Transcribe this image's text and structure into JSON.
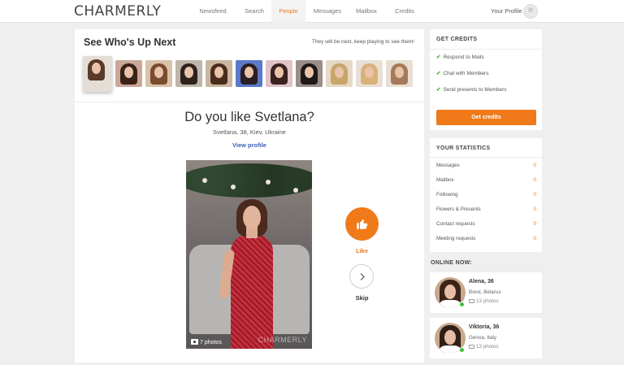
{
  "header": {
    "logo": "CHARMERLY",
    "nav": [
      {
        "label": "Newsfeed",
        "active": false
      },
      {
        "label": "Search",
        "active": false
      },
      {
        "label": "People",
        "active": true
      },
      {
        "label": "Messages",
        "active": false
      },
      {
        "label": "Mailbox",
        "active": false
      },
      {
        "label": "Credits",
        "active": false
      }
    ],
    "profile_label": "Your Profile"
  },
  "up_next": {
    "title": "See Who's Up Next",
    "subtitle": "They will be next, keep playing to see them!",
    "thumbs": [
      {
        "hair": "#5a3a2a",
        "bg": "#e3ddd6"
      },
      {
        "hair": "#3b2218",
        "bg": "#c9a89a"
      },
      {
        "hair": "#7a4b2e",
        "bg": "#d8c3a8"
      },
      {
        "hair": "#2e221e",
        "bg": "#bfb5ab"
      },
      {
        "hair": "#4b2c1c",
        "bg": "#c9b79f"
      },
      {
        "hair": "#2a1f22",
        "bg": "#5b79c9"
      },
      {
        "hair": "#3b2220",
        "bg": "#e0c3c6"
      },
      {
        "hair": "#1e1818",
        "bg": "#9a8f88"
      },
      {
        "hair": "#c9a56a",
        "bg": "#e6d9c8"
      },
      {
        "hair": "#d9b27a",
        "bg": "#e8e0d6"
      },
      {
        "hair": "#a57a5a",
        "bg": "#e9ded2"
      }
    ]
  },
  "match": {
    "question": "Do you like Svetlana?",
    "info": "Svetlana, 38, Kiev, Ukraine",
    "view_profile": "View profile",
    "photo_count": "7 photos",
    "watermark": "CHARMERLY",
    "like_label": "Like",
    "skip_label": "Skip"
  },
  "credits": {
    "title": "GET CREDITS",
    "items": [
      "Respond to Mails",
      "Chat with Members",
      "Send presents to Members"
    ],
    "button": "Get credits"
  },
  "stats": {
    "title": "YOUR STATISTICS",
    "rows": [
      {
        "label": "Messages",
        "value": "0"
      },
      {
        "label": "Mailbox",
        "value": "0"
      },
      {
        "label": "Following",
        "value": "0"
      },
      {
        "label": "Flowers & Presents",
        "value": "0"
      },
      {
        "label": "Contact requests",
        "value": "0"
      },
      {
        "label": "Meeting requests",
        "value": "0"
      }
    ]
  },
  "online": {
    "title": "ONLINE NOW:",
    "members": [
      {
        "name": "Alena, 36",
        "location": "Brest, Belarus",
        "photos": "13 photos"
      },
      {
        "name": "Viktoria, 36",
        "location": "Genoa, Italy",
        "photos": "13 photos"
      }
    ]
  },
  "colors": {
    "accent": "#f07a1a",
    "link": "#3b63b5",
    "online": "#3cc03c",
    "check": "#4cab3c"
  }
}
